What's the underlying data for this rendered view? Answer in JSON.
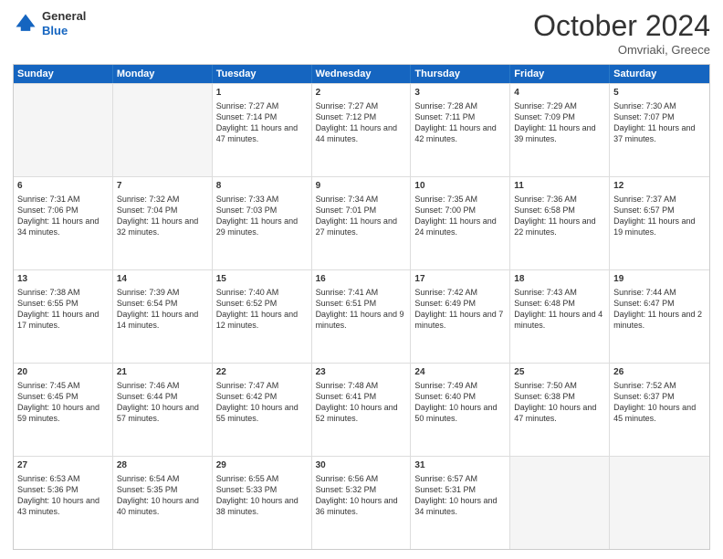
{
  "header": {
    "logo": {
      "general": "General",
      "blue": "Blue"
    },
    "title": "October 2024",
    "location": "Omvriaki, Greece"
  },
  "days_of_week": [
    "Sunday",
    "Monday",
    "Tuesday",
    "Wednesday",
    "Thursday",
    "Friday",
    "Saturday"
  ],
  "weeks": [
    [
      {
        "day": null,
        "sunrise": null,
        "sunset": null,
        "daylight": null
      },
      {
        "day": null,
        "sunrise": null,
        "sunset": null,
        "daylight": null
      },
      {
        "day": "1",
        "sunrise": "Sunrise: 7:27 AM",
        "sunset": "Sunset: 7:14 PM",
        "daylight": "Daylight: 11 hours and 47 minutes."
      },
      {
        "day": "2",
        "sunrise": "Sunrise: 7:27 AM",
        "sunset": "Sunset: 7:12 PM",
        "daylight": "Daylight: 11 hours and 44 minutes."
      },
      {
        "day": "3",
        "sunrise": "Sunrise: 7:28 AM",
        "sunset": "Sunset: 7:11 PM",
        "daylight": "Daylight: 11 hours and 42 minutes."
      },
      {
        "day": "4",
        "sunrise": "Sunrise: 7:29 AM",
        "sunset": "Sunset: 7:09 PM",
        "daylight": "Daylight: 11 hours and 39 minutes."
      },
      {
        "day": "5",
        "sunrise": "Sunrise: 7:30 AM",
        "sunset": "Sunset: 7:07 PM",
        "daylight": "Daylight: 11 hours and 37 minutes."
      }
    ],
    [
      {
        "day": "6",
        "sunrise": "Sunrise: 7:31 AM",
        "sunset": "Sunset: 7:06 PM",
        "daylight": "Daylight: 11 hours and 34 minutes."
      },
      {
        "day": "7",
        "sunrise": "Sunrise: 7:32 AM",
        "sunset": "Sunset: 7:04 PM",
        "daylight": "Daylight: 11 hours and 32 minutes."
      },
      {
        "day": "8",
        "sunrise": "Sunrise: 7:33 AM",
        "sunset": "Sunset: 7:03 PM",
        "daylight": "Daylight: 11 hours and 29 minutes."
      },
      {
        "day": "9",
        "sunrise": "Sunrise: 7:34 AM",
        "sunset": "Sunset: 7:01 PM",
        "daylight": "Daylight: 11 hours and 27 minutes."
      },
      {
        "day": "10",
        "sunrise": "Sunrise: 7:35 AM",
        "sunset": "Sunset: 7:00 PM",
        "daylight": "Daylight: 11 hours and 24 minutes."
      },
      {
        "day": "11",
        "sunrise": "Sunrise: 7:36 AM",
        "sunset": "Sunset: 6:58 PM",
        "daylight": "Daylight: 11 hours and 22 minutes."
      },
      {
        "day": "12",
        "sunrise": "Sunrise: 7:37 AM",
        "sunset": "Sunset: 6:57 PM",
        "daylight": "Daylight: 11 hours and 19 minutes."
      }
    ],
    [
      {
        "day": "13",
        "sunrise": "Sunrise: 7:38 AM",
        "sunset": "Sunset: 6:55 PM",
        "daylight": "Daylight: 11 hours and 17 minutes."
      },
      {
        "day": "14",
        "sunrise": "Sunrise: 7:39 AM",
        "sunset": "Sunset: 6:54 PM",
        "daylight": "Daylight: 11 hours and 14 minutes."
      },
      {
        "day": "15",
        "sunrise": "Sunrise: 7:40 AM",
        "sunset": "Sunset: 6:52 PM",
        "daylight": "Daylight: 11 hours and 12 minutes."
      },
      {
        "day": "16",
        "sunrise": "Sunrise: 7:41 AM",
        "sunset": "Sunset: 6:51 PM",
        "daylight": "Daylight: 11 hours and 9 minutes."
      },
      {
        "day": "17",
        "sunrise": "Sunrise: 7:42 AM",
        "sunset": "Sunset: 6:49 PM",
        "daylight": "Daylight: 11 hours and 7 minutes."
      },
      {
        "day": "18",
        "sunrise": "Sunrise: 7:43 AM",
        "sunset": "Sunset: 6:48 PM",
        "daylight": "Daylight: 11 hours and 4 minutes."
      },
      {
        "day": "19",
        "sunrise": "Sunrise: 7:44 AM",
        "sunset": "Sunset: 6:47 PM",
        "daylight": "Daylight: 11 hours and 2 minutes."
      }
    ],
    [
      {
        "day": "20",
        "sunrise": "Sunrise: 7:45 AM",
        "sunset": "Sunset: 6:45 PM",
        "daylight": "Daylight: 10 hours and 59 minutes."
      },
      {
        "day": "21",
        "sunrise": "Sunrise: 7:46 AM",
        "sunset": "Sunset: 6:44 PM",
        "daylight": "Daylight: 10 hours and 57 minutes."
      },
      {
        "day": "22",
        "sunrise": "Sunrise: 7:47 AM",
        "sunset": "Sunset: 6:42 PM",
        "daylight": "Daylight: 10 hours and 55 minutes."
      },
      {
        "day": "23",
        "sunrise": "Sunrise: 7:48 AM",
        "sunset": "Sunset: 6:41 PM",
        "daylight": "Daylight: 10 hours and 52 minutes."
      },
      {
        "day": "24",
        "sunrise": "Sunrise: 7:49 AM",
        "sunset": "Sunset: 6:40 PM",
        "daylight": "Daylight: 10 hours and 50 minutes."
      },
      {
        "day": "25",
        "sunrise": "Sunrise: 7:50 AM",
        "sunset": "Sunset: 6:38 PM",
        "daylight": "Daylight: 10 hours and 47 minutes."
      },
      {
        "day": "26",
        "sunrise": "Sunrise: 7:52 AM",
        "sunset": "Sunset: 6:37 PM",
        "daylight": "Daylight: 10 hours and 45 minutes."
      }
    ],
    [
      {
        "day": "27",
        "sunrise": "Sunrise: 6:53 AM",
        "sunset": "Sunset: 5:36 PM",
        "daylight": "Daylight: 10 hours and 43 minutes."
      },
      {
        "day": "28",
        "sunrise": "Sunrise: 6:54 AM",
        "sunset": "Sunset: 5:35 PM",
        "daylight": "Daylight: 10 hours and 40 minutes."
      },
      {
        "day": "29",
        "sunrise": "Sunrise: 6:55 AM",
        "sunset": "Sunset: 5:33 PM",
        "daylight": "Daylight: 10 hours and 38 minutes."
      },
      {
        "day": "30",
        "sunrise": "Sunrise: 6:56 AM",
        "sunset": "Sunset: 5:32 PM",
        "daylight": "Daylight: 10 hours and 36 minutes."
      },
      {
        "day": "31",
        "sunrise": "Sunrise: 6:57 AM",
        "sunset": "Sunset: 5:31 PM",
        "daylight": "Daylight: 10 hours and 34 minutes."
      },
      {
        "day": null,
        "sunrise": null,
        "sunset": null,
        "daylight": null
      },
      {
        "day": null,
        "sunrise": null,
        "sunset": null,
        "daylight": null
      }
    ]
  ]
}
